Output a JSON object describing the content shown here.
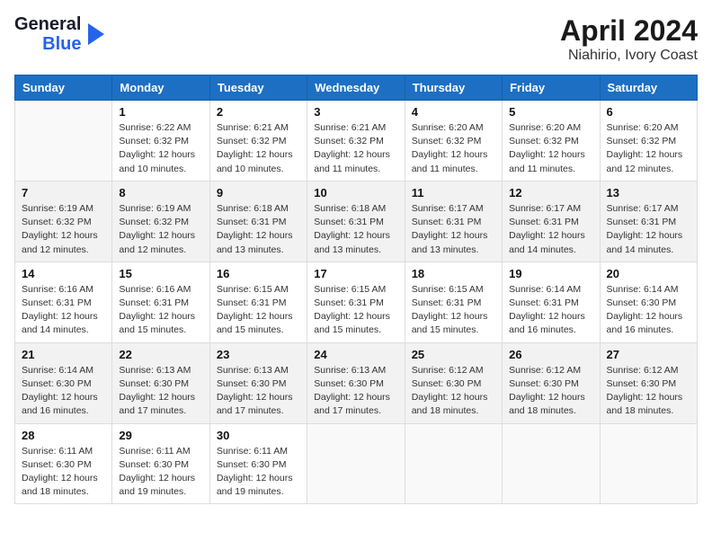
{
  "header": {
    "logo_line1": "General",
    "logo_line2": "Blue",
    "main_title": "April 2024",
    "subtitle": "Niahirio, Ivory Coast"
  },
  "calendar": {
    "columns": [
      "Sunday",
      "Monday",
      "Tuesday",
      "Wednesday",
      "Thursday",
      "Friday",
      "Saturday"
    ],
    "weeks": [
      [
        {
          "day": "",
          "detail": ""
        },
        {
          "day": "1",
          "detail": "Sunrise: 6:22 AM\nSunset: 6:32 PM\nDaylight: 12 hours\nand 10 minutes."
        },
        {
          "day": "2",
          "detail": "Sunrise: 6:21 AM\nSunset: 6:32 PM\nDaylight: 12 hours\nand 10 minutes."
        },
        {
          "day": "3",
          "detail": "Sunrise: 6:21 AM\nSunset: 6:32 PM\nDaylight: 12 hours\nand 11 minutes."
        },
        {
          "day": "4",
          "detail": "Sunrise: 6:20 AM\nSunset: 6:32 PM\nDaylight: 12 hours\nand 11 minutes."
        },
        {
          "day": "5",
          "detail": "Sunrise: 6:20 AM\nSunset: 6:32 PM\nDaylight: 12 hours\nand 11 minutes."
        },
        {
          "day": "6",
          "detail": "Sunrise: 6:20 AM\nSunset: 6:32 PM\nDaylight: 12 hours\nand 12 minutes."
        }
      ],
      [
        {
          "day": "7",
          "detail": "Sunrise: 6:19 AM\nSunset: 6:32 PM\nDaylight: 12 hours\nand 12 minutes."
        },
        {
          "day": "8",
          "detail": "Sunrise: 6:19 AM\nSunset: 6:32 PM\nDaylight: 12 hours\nand 12 minutes."
        },
        {
          "day": "9",
          "detail": "Sunrise: 6:18 AM\nSunset: 6:31 PM\nDaylight: 12 hours\nand 13 minutes."
        },
        {
          "day": "10",
          "detail": "Sunrise: 6:18 AM\nSunset: 6:31 PM\nDaylight: 12 hours\nand 13 minutes."
        },
        {
          "day": "11",
          "detail": "Sunrise: 6:17 AM\nSunset: 6:31 PM\nDaylight: 12 hours\nand 13 minutes."
        },
        {
          "day": "12",
          "detail": "Sunrise: 6:17 AM\nSunset: 6:31 PM\nDaylight: 12 hours\nand 14 minutes."
        },
        {
          "day": "13",
          "detail": "Sunrise: 6:17 AM\nSunset: 6:31 PM\nDaylight: 12 hours\nand 14 minutes."
        }
      ],
      [
        {
          "day": "14",
          "detail": "Sunrise: 6:16 AM\nSunset: 6:31 PM\nDaylight: 12 hours\nand 14 minutes."
        },
        {
          "day": "15",
          "detail": "Sunrise: 6:16 AM\nSunset: 6:31 PM\nDaylight: 12 hours\nand 15 minutes."
        },
        {
          "day": "16",
          "detail": "Sunrise: 6:15 AM\nSunset: 6:31 PM\nDaylight: 12 hours\nand 15 minutes."
        },
        {
          "day": "17",
          "detail": "Sunrise: 6:15 AM\nSunset: 6:31 PM\nDaylight: 12 hours\nand 15 minutes."
        },
        {
          "day": "18",
          "detail": "Sunrise: 6:15 AM\nSunset: 6:31 PM\nDaylight: 12 hours\nand 15 minutes."
        },
        {
          "day": "19",
          "detail": "Sunrise: 6:14 AM\nSunset: 6:31 PM\nDaylight: 12 hours\nand 16 minutes."
        },
        {
          "day": "20",
          "detail": "Sunrise: 6:14 AM\nSunset: 6:30 PM\nDaylight: 12 hours\nand 16 minutes."
        }
      ],
      [
        {
          "day": "21",
          "detail": "Sunrise: 6:14 AM\nSunset: 6:30 PM\nDaylight: 12 hours\nand 16 minutes."
        },
        {
          "day": "22",
          "detail": "Sunrise: 6:13 AM\nSunset: 6:30 PM\nDaylight: 12 hours\nand 17 minutes."
        },
        {
          "day": "23",
          "detail": "Sunrise: 6:13 AM\nSunset: 6:30 PM\nDaylight: 12 hours\nand 17 minutes."
        },
        {
          "day": "24",
          "detail": "Sunrise: 6:13 AM\nSunset: 6:30 PM\nDaylight: 12 hours\nand 17 minutes."
        },
        {
          "day": "25",
          "detail": "Sunrise: 6:12 AM\nSunset: 6:30 PM\nDaylight: 12 hours\nand 18 minutes."
        },
        {
          "day": "26",
          "detail": "Sunrise: 6:12 AM\nSunset: 6:30 PM\nDaylight: 12 hours\nand 18 minutes."
        },
        {
          "day": "27",
          "detail": "Sunrise: 6:12 AM\nSunset: 6:30 PM\nDaylight: 12 hours\nand 18 minutes."
        }
      ],
      [
        {
          "day": "28",
          "detail": "Sunrise: 6:11 AM\nSunset: 6:30 PM\nDaylight: 12 hours\nand 18 minutes."
        },
        {
          "day": "29",
          "detail": "Sunrise: 6:11 AM\nSunset: 6:30 PM\nDaylight: 12 hours\nand 19 minutes."
        },
        {
          "day": "30",
          "detail": "Sunrise: 6:11 AM\nSunset: 6:30 PM\nDaylight: 12 hours\nand 19 minutes."
        },
        {
          "day": "",
          "detail": ""
        },
        {
          "day": "",
          "detail": ""
        },
        {
          "day": "",
          "detail": ""
        },
        {
          "day": "",
          "detail": ""
        }
      ]
    ]
  }
}
